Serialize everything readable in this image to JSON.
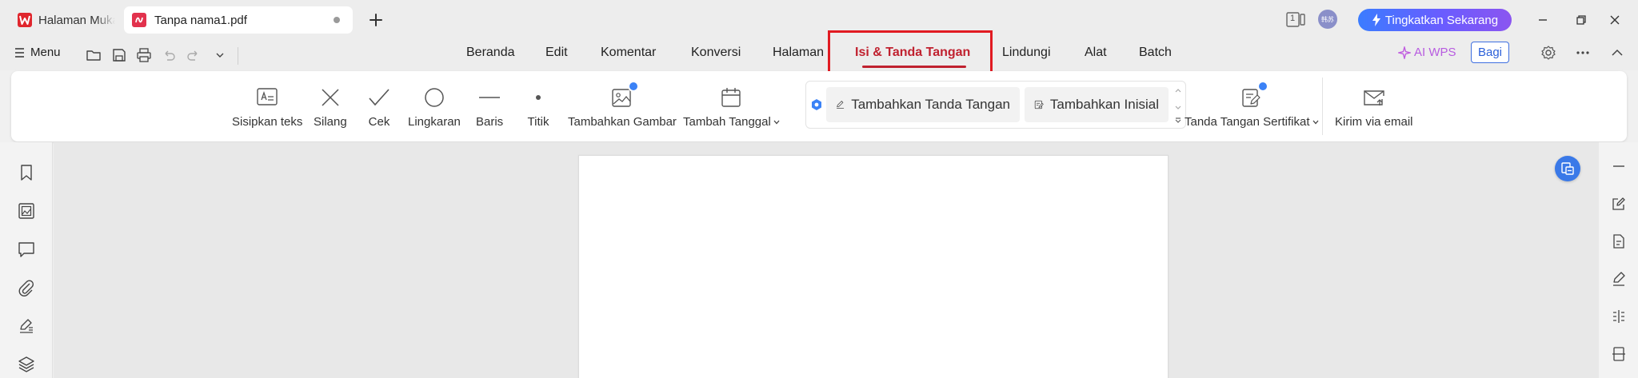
{
  "titlebar": {
    "tabs": [
      {
        "label": "Halaman Muka",
        "icon": "wps-logo-icon"
      },
      {
        "label": "Tanpa nama1.pdf",
        "icon": "pdf-icon"
      }
    ],
    "page_indicator": "1",
    "avatar_text": "韩苏",
    "upgrade_label": "Tingkatkan Sekarang"
  },
  "menubar": {
    "menu_label": "Menu",
    "tabs": [
      "Beranda",
      "Edit",
      "Komentar",
      "Konversi",
      "Halaman",
      "Isi & Tanda Tangan",
      "Lindungi",
      "Alat",
      "Batch"
    ],
    "active_tab": "Isi & Tanda Tangan",
    "ai_label": "AI WPS",
    "share_label": "Bagi"
  },
  "ribbon": {
    "tools": [
      {
        "label": "Sisipkan teks",
        "icon": "insert-text-icon"
      },
      {
        "label": "Silang",
        "icon": "cross-icon"
      },
      {
        "label": "Cek",
        "icon": "check-icon"
      },
      {
        "label": "Lingkaran",
        "icon": "circle-icon"
      },
      {
        "label": "Baris",
        "icon": "line-icon"
      },
      {
        "label": "Titik",
        "icon": "dot-icon"
      },
      {
        "label": "Tambahkan Gambar",
        "icon": "image-icon"
      },
      {
        "label": "Tambah Tanggal",
        "icon": "calendar-icon"
      }
    ],
    "signature": {
      "add_signature": "Tambahkan Tanda Tangan",
      "add_initial": "Tambahkan Inisial"
    },
    "cert_signature": "Tanda Tangan Sertifikat",
    "send_email": "Kirim via email"
  },
  "colors": {
    "accent": "#c0212f",
    "highlight_box": "#e11b22",
    "upgrade_gradient_start": "#3b7cff",
    "upgrade_gradient_end": "#8b55f0",
    "primary_blue": "#3a79e8"
  }
}
